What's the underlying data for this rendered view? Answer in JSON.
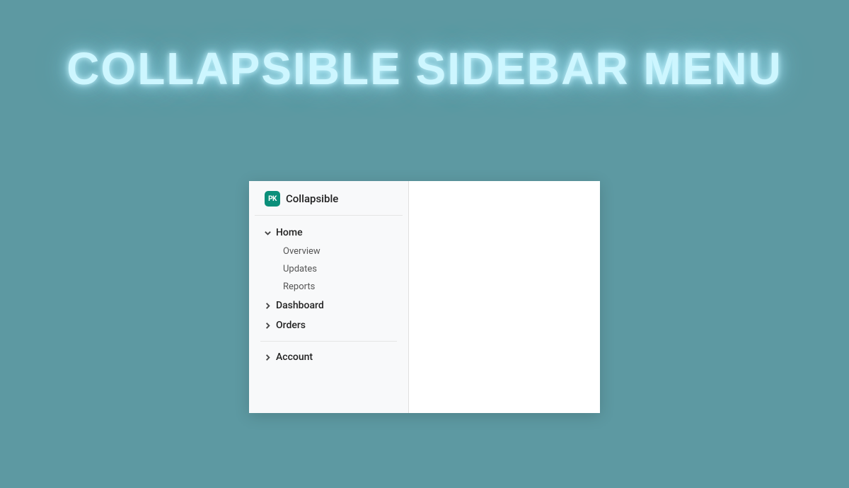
{
  "page": {
    "title": "COLLAPSIBLE SIDEBAR MENU"
  },
  "sidebar": {
    "logo_text": "PK",
    "brand": "Collapsible",
    "sections": [
      {
        "label": "Home",
        "expanded": true,
        "children": [
          {
            "label": "Overview"
          },
          {
            "label": "Updates"
          },
          {
            "label": "Reports"
          }
        ]
      },
      {
        "label": "Dashboard",
        "expanded": false
      },
      {
        "label": "Orders",
        "expanded": false
      }
    ],
    "bottom_sections": [
      {
        "label": "Account",
        "expanded": false
      }
    ]
  }
}
